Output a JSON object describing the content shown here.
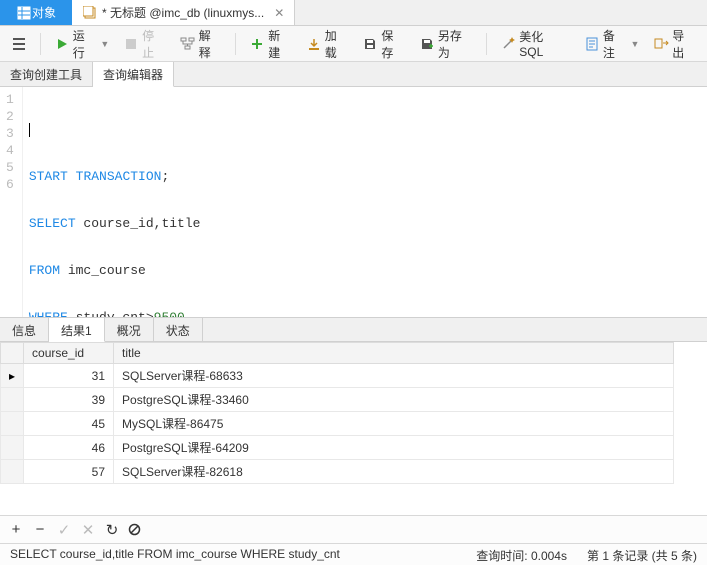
{
  "topTabs": {
    "objects": "对象",
    "file": "* 无标题 @imc_db (linuxmys..."
  },
  "toolbar": {
    "run": "运行",
    "stop": "停止",
    "explain": "解释",
    "new": "新建",
    "load": "加载",
    "save": "保存",
    "saveAs": "另存为",
    "beautify": "美化 SQL",
    "notes": "备注",
    "export": "导出"
  },
  "subtabs": {
    "builder": "查询创建工具",
    "editor": "查询编辑器"
  },
  "sql": {
    "l1": "",
    "l2": {
      "a": "START",
      "b": "TRANSACTION",
      "c": ";"
    },
    "l3": {
      "a": "SELECT",
      "b": " course_id,title"
    },
    "l4": {
      "a": "FROM",
      "b": " imc_course"
    },
    "l5": {
      "a": "WHERE",
      "b": " study_cnt>",
      "c": "9500"
    },
    "l6": ";"
  },
  "resultTabs": {
    "info": "信息",
    "result": "结果1",
    "profile": "概况",
    "status": "状态"
  },
  "columns": {
    "c1": "course_id",
    "c2": "title"
  },
  "rows": [
    {
      "id": "31",
      "title": "SQLServer课程-68633"
    },
    {
      "id": "39",
      "title": "PostgreSQL课程-33460"
    },
    {
      "id": "45",
      "title": "MySQL课程-86475"
    },
    {
      "id": "46",
      "title": "PostgreSQL课程-64209"
    },
    {
      "id": "57",
      "title": "SQLServer课程-82618"
    }
  ],
  "status": {
    "query": "SELECT course_id,title FROM imc_course WHERE study_cnt",
    "time": "查询时间: 0.004s",
    "record": "第 1 条记录 (共 5 条)"
  },
  "lineNums": [
    "1",
    "2",
    "3",
    "4",
    "5",
    "6"
  ]
}
